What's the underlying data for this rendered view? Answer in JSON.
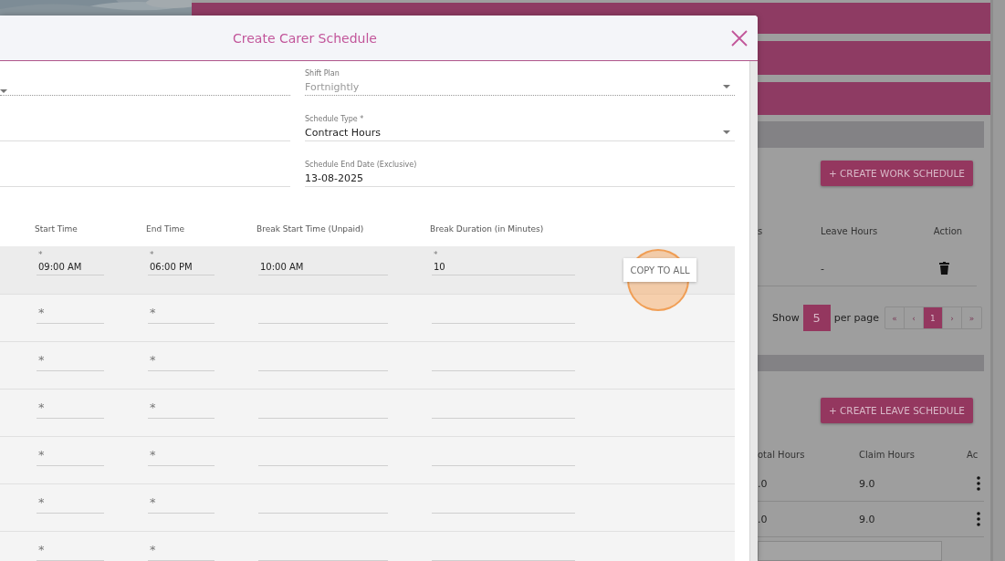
{
  "background_page": {
    "work_schedule": {
      "button": "+ CREATE WORK SCHEDULE",
      "columns": [
        "s",
        "Leave Hours",
        "Action"
      ],
      "rows": [
        {
          "cells": [
            "",
            "-"
          ]
        }
      ],
      "pagination": {
        "show_label": "Show",
        "page_size": "5",
        "per_page_label": "per page",
        "pages": [
          {
            "label": "«",
            "selected": false
          },
          {
            "label": "‹",
            "selected": false
          },
          {
            "label": "1",
            "selected": true
          },
          {
            "label": "›",
            "selected": false
          },
          {
            "label": "»",
            "selected": false
          }
        ]
      }
    },
    "leave_schedule": {
      "button": "+ CREATE LEAVE SCHEDULE",
      "columns": [
        "otal Hours",
        "Claim Hours",
        "Ac"
      ],
      "rows": [
        {
          "cells": [
            ".0",
            "9.0"
          ]
        },
        {
          "cells": [
            ".0",
            "9.0"
          ]
        }
      ]
    }
  },
  "dialog": {
    "title": "Create Carer Schedule",
    "form_rows": [
      {
        "left": {
          "kind": "select",
          "disabled": true
        },
        "right": {
          "kind": "select",
          "label": "Shift Plan",
          "value": "Fortnightly",
          "disabled": true
        }
      },
      {
        "left": {
          "kind": "text",
          "disabled": false
        },
        "right": {
          "kind": "select",
          "label": "Schedule Type *",
          "value": "Contract Hours",
          "disabled": false
        }
      },
      {
        "left": {
          "kind": "text",
          "disabled": false
        },
        "right": {
          "kind": "date",
          "label": "Schedule End Date (Exclusive)",
          "value": "13-08-2025",
          "disabled": false
        }
      }
    ],
    "table": {
      "columns": [
        "Start Time",
        "End Time",
        "Break Start Time (Unpaid)",
        "Break Duration (in Minutes)"
      ],
      "rows": [
        {
          "selected": true,
          "cells": [
            {
              "mark": "*",
              "value": "09:00 AM"
            },
            {
              "mark": "*",
              "value": "06:00 PM"
            },
            {
              "value": "10:00 AM"
            },
            {
              "mark": "*",
              "value": "10"
            }
          ],
          "copy_button": {
            "label": "COPY TO ALL",
            "clicked": true
          }
        },
        {
          "selected": false,
          "cells": [
            {
              "mark": "*"
            },
            {
              "mark": "*"
            },
            {},
            {}
          ]
        },
        {
          "selected": false,
          "cells": [
            {
              "mark": "*"
            },
            {
              "mark": "*"
            },
            {},
            {}
          ]
        },
        {
          "selected": false,
          "cells": [
            {
              "mark": "*"
            },
            {
              "mark": "*"
            },
            {},
            {}
          ]
        },
        {
          "selected": false,
          "cells": [
            {
              "mark": "*"
            },
            {
              "mark": "*"
            },
            {},
            {}
          ]
        },
        {
          "selected": false,
          "cells": [
            {
              "mark": "*"
            },
            {
              "mark": "*"
            },
            {},
            {}
          ]
        },
        {
          "selected": false,
          "cells": [
            {
              "mark": "*"
            },
            {
              "mark": "*"
            },
            {},
            {}
          ]
        }
      ]
    }
  }
}
